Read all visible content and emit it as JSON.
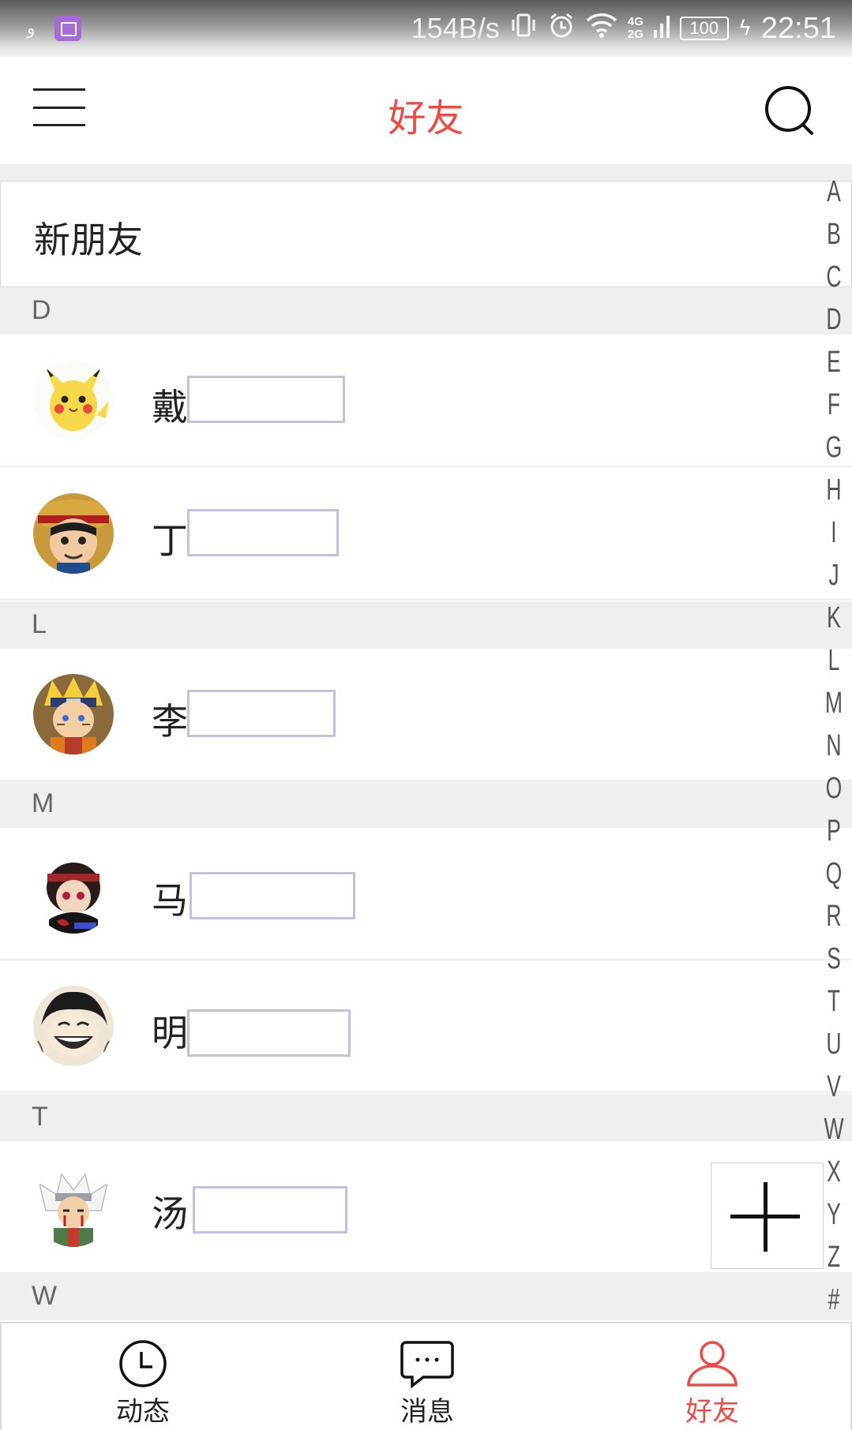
{
  "status_bar": {
    "left_glyph": "ﻭ",
    "speed": "154B/s",
    "net_top": "4G",
    "net_bottom": "2G",
    "battery": "100",
    "time": "22:51",
    "icons": [
      "image-notification-icon",
      "vibrate-icon",
      "alarm-icon",
      "wifi-icon",
      "signal-icon",
      "battery-icon",
      "charging-icon"
    ]
  },
  "header": {
    "title": "好友",
    "menu_icon": "menu-icon",
    "search_icon": "search-icon"
  },
  "new_friends": {
    "label": "新朋友"
  },
  "sections": [
    {
      "letter": "D",
      "friends": [
        {
          "name": "戴",
          "avatar": "pikachu"
        },
        {
          "name": "丁",
          "avatar": "luffy-straw-hat"
        }
      ]
    },
    {
      "letter": "L",
      "friends": [
        {
          "name": "李",
          "avatar": "naruto"
        }
      ]
    },
    {
      "letter": "M",
      "friends": [
        {
          "name": "马",
          "avatar": "itachi"
        },
        {
          "name": "明",
          "avatar": "luffy-laughing"
        }
      ]
    },
    {
      "letter": "T",
      "friends": [
        {
          "name": "汤",
          "avatar": "jiraiya"
        }
      ]
    },
    {
      "letter": "W",
      "friends": []
    }
  ],
  "index": [
    "A",
    "B",
    "C",
    "D",
    "E",
    "F",
    "G",
    "H",
    "I",
    "J",
    "K",
    "L",
    "M",
    "N",
    "O",
    "P",
    "Q",
    "R",
    "S",
    "T",
    "U",
    "V",
    "W",
    "X",
    "Y",
    "Z",
    "#"
  ],
  "fab": {
    "icon": "plus-icon"
  },
  "tabs": [
    {
      "label": "动态",
      "icon": "clock-icon",
      "active": false
    },
    {
      "label": "消息",
      "icon": "chat-bubble-icon",
      "active": false
    },
    {
      "label": "好友",
      "icon": "person-icon",
      "active": true
    }
  ],
  "colors": {
    "accent": "#ef4b45",
    "separator": "#efefef",
    "name_box_border": "#c6bde0"
  }
}
